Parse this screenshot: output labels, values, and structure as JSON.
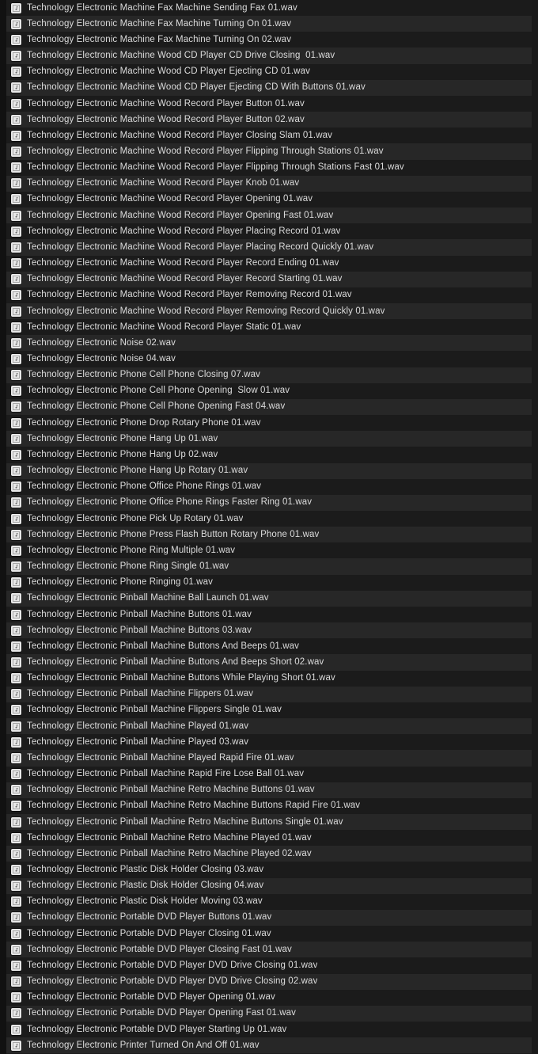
{
  "window": {
    "title": "Sound Library File List",
    "background_color": "#1c1c1c",
    "row_color_dark": "#1b1b1b",
    "row_color_light": "#272727",
    "text_color": "#dcdcdc",
    "icon_color": "#e8e8e8",
    "gutter_color": "#111111"
  },
  "list": {
    "icon_name": "audio-file-icon",
    "row_count": 66,
    "items": [
      {
        "name": "Technology Electronic Machine Fax Machine Sending Fax 01.wav"
      },
      {
        "name": "Technology Electronic Machine Fax Machine Turning On 01.wav"
      },
      {
        "name": "Technology Electronic Machine Fax Machine Turning On 02.wav"
      },
      {
        "name": "Technology Electronic Machine Wood CD Player CD Drive Closing  01.wav"
      },
      {
        "name": "Technology Electronic Machine Wood CD Player Ejecting CD 01.wav"
      },
      {
        "name": "Technology Electronic Machine Wood CD Player Ejecting CD With Buttons 01.wav"
      },
      {
        "name": "Technology Electronic Machine Wood Record Player Button 01.wav"
      },
      {
        "name": "Technology Electronic Machine Wood Record Player Button 02.wav"
      },
      {
        "name": "Technology Electronic Machine Wood Record Player Closing Slam 01.wav"
      },
      {
        "name": "Technology Electronic Machine Wood Record Player Flipping Through Stations 01.wav"
      },
      {
        "name": "Technology Electronic Machine Wood Record Player Flipping Through Stations Fast 01.wav"
      },
      {
        "name": "Technology Electronic Machine Wood Record Player Knob 01.wav"
      },
      {
        "name": "Technology Electronic Machine Wood Record Player Opening 01.wav"
      },
      {
        "name": "Technology Electronic Machine Wood Record Player Opening Fast 01.wav"
      },
      {
        "name": "Technology Electronic Machine Wood Record Player Placing Record 01.wav"
      },
      {
        "name": "Technology Electronic Machine Wood Record Player Placing Record Quickly 01.wav"
      },
      {
        "name": "Technology Electronic Machine Wood Record Player Record Ending 01.wav"
      },
      {
        "name": "Technology Electronic Machine Wood Record Player Record Starting 01.wav"
      },
      {
        "name": "Technology Electronic Machine Wood Record Player Removing Record 01.wav"
      },
      {
        "name": "Technology Electronic Machine Wood Record Player Removing Record Quickly 01.wav"
      },
      {
        "name": "Technology Electronic Machine Wood Record Player Static 01.wav"
      },
      {
        "name": "Technology Electronic Noise 02.wav"
      },
      {
        "name": "Technology Electronic Noise 04.wav"
      },
      {
        "name": "Technology Electronic Phone Cell Phone Closing 07.wav"
      },
      {
        "name": "Technology Electronic Phone Cell Phone Opening  Slow 01.wav"
      },
      {
        "name": "Technology Electronic Phone Cell Phone Opening Fast 04.wav"
      },
      {
        "name": "Technology Electronic Phone Drop Rotary Phone 01.wav"
      },
      {
        "name": "Technology Electronic Phone Hang Up 01.wav"
      },
      {
        "name": "Technology Electronic Phone Hang Up 02.wav"
      },
      {
        "name": "Technology Electronic Phone Hang Up Rotary 01.wav"
      },
      {
        "name": "Technology Electronic Phone Office Phone Rings 01.wav"
      },
      {
        "name": "Technology Electronic Phone Office Phone Rings Faster Ring 01.wav"
      },
      {
        "name": "Technology Electronic Phone Pick Up Rotary 01.wav"
      },
      {
        "name": "Technology Electronic Phone Press Flash Button Rotary Phone 01.wav"
      },
      {
        "name": "Technology Electronic Phone Ring Multiple 01.wav"
      },
      {
        "name": "Technology Electronic Phone Ring Single 01.wav"
      },
      {
        "name": "Technology Electronic Phone Ringing 01.wav"
      },
      {
        "name": "Technology Electronic Pinball Machine Ball Launch 01.wav"
      },
      {
        "name": "Technology Electronic Pinball Machine Buttons 01.wav"
      },
      {
        "name": "Technology Electronic Pinball Machine Buttons 03.wav"
      },
      {
        "name": "Technology Electronic Pinball Machine Buttons And Beeps 01.wav"
      },
      {
        "name": "Technology Electronic Pinball Machine Buttons And Beeps Short 02.wav"
      },
      {
        "name": "Technology Electronic Pinball Machine Buttons While Playing Short 01.wav"
      },
      {
        "name": "Technology Electronic Pinball Machine Flippers 01.wav"
      },
      {
        "name": "Technology Electronic Pinball Machine Flippers Single 01.wav"
      },
      {
        "name": "Technology Electronic Pinball Machine Played 01.wav"
      },
      {
        "name": "Technology Electronic Pinball Machine Played 03.wav"
      },
      {
        "name": "Technology Electronic Pinball Machine Played Rapid Fire 01.wav"
      },
      {
        "name": "Technology Electronic Pinball Machine Rapid Fire Lose Ball 01.wav"
      },
      {
        "name": "Technology Electronic Pinball Machine Retro Machine Buttons 01.wav"
      },
      {
        "name": "Technology Electronic Pinball Machine Retro Machine Buttons Rapid Fire 01.wav"
      },
      {
        "name": "Technology Electronic Pinball Machine Retro Machine Buttons Single 01.wav"
      },
      {
        "name": "Technology Electronic Pinball Machine Retro Machine Played 01.wav"
      },
      {
        "name": "Technology Electronic Pinball Machine Retro Machine Played 02.wav"
      },
      {
        "name": "Technology Electronic Plastic Disk Holder Closing 03.wav"
      },
      {
        "name": "Technology Electronic Plastic Disk Holder Closing 04.wav"
      },
      {
        "name": "Technology Electronic Plastic Disk Holder Moving 03.wav"
      },
      {
        "name": "Technology Electronic Portable DVD Player Buttons 01.wav"
      },
      {
        "name": "Technology Electronic Portable DVD Player Closing 01.wav"
      },
      {
        "name": "Technology Electronic Portable DVD Player Closing Fast 01.wav"
      },
      {
        "name": "Technology Electronic Portable DVD Player DVD Drive Closing 01.wav"
      },
      {
        "name": "Technology Electronic Portable DVD Player DVD Drive Closing 02.wav"
      },
      {
        "name": "Technology Electronic Portable DVD Player Opening 01.wav"
      },
      {
        "name": "Technology Electronic Portable DVD Player Opening Fast 01.wav"
      },
      {
        "name": "Technology Electronic Portable DVD Player Starting Up 01.wav"
      },
      {
        "name": "Technology Electronic Printer Turned On And Off 01.wav"
      }
    ]
  }
}
